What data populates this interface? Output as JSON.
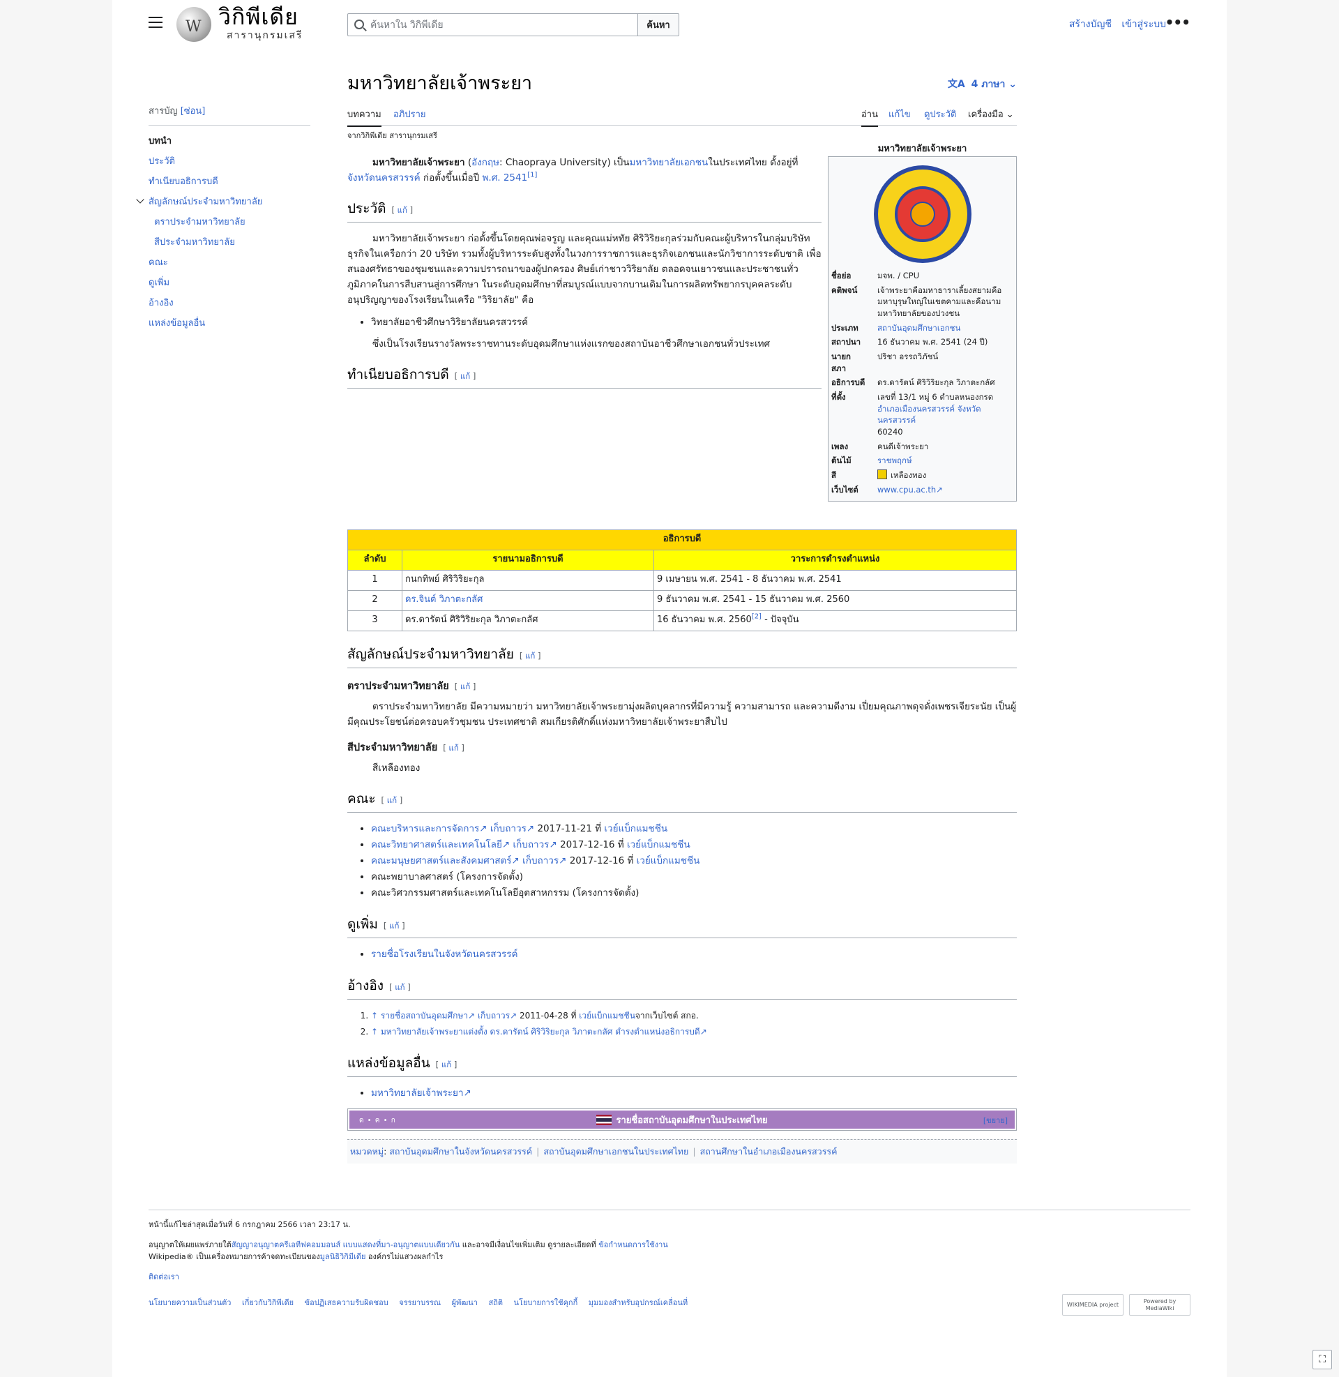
{
  "header": {
    "site_title": "วิกิพีเดีย",
    "site_tagline": "สารานุกรมเสรี",
    "search_placeholder": "ค้นหาใน วิกิพีเดีย",
    "search_button": "ค้นหา",
    "create_account": "สร้างบัญชี",
    "login": "เข้าสู่ระบบ"
  },
  "toc": {
    "heading": "สารบัญ",
    "hide": "[ซ่อน]",
    "items": [
      {
        "label": "บทนำ"
      },
      {
        "label": "ประวัติ"
      },
      {
        "label": "ทำเนียบอธิการบดี"
      },
      {
        "label": "สัญลักษณ์ประจำมหาวิทยาลัย"
      },
      {
        "label": "ตราประจำมหาวิทยาลัย"
      },
      {
        "label": "สีประจำมหาวิทยาลัย"
      },
      {
        "label": "คณะ"
      },
      {
        "label": "ดูเพิ่ม"
      },
      {
        "label": "อ้างอิง"
      },
      {
        "label": "แหล่งข้อมูลอื่น"
      }
    ]
  },
  "article": {
    "title": "มหาวิทยาลัยเจ้าพระยา",
    "languages": "4 ภาษา",
    "tabs": {
      "article": "บทความ",
      "talk": "อภิปราย",
      "read": "อ่าน",
      "edit": "แก้ไข",
      "history": "ดูประวัติ",
      "tools": "เครื่องมือ"
    },
    "from": "จากวิกิพีเดีย สารานุกรมเสรี",
    "edit_label": "แก้",
    "lead": {
      "bold": "มหาวิทยาลัยเจ้าพระยา",
      "open": " (",
      "lang_link": "อังกฤษ",
      "en_name": ": Chaopraya University) เป็น",
      "link1": "มหาวิทยาลัยเอกชน",
      "mid": "ในประเทศไทย ตั้งอยู่ที่",
      "link2": "จังหวัดนครสวรรค์",
      "mid2": " ก่อตั้งขึ้นเมื่อปี ",
      "link3": "พ.ศ. 2541",
      "ref": "[1]"
    },
    "sections": {
      "history": "ประวัติ",
      "deans": "ทำเนียบอธิการบดี",
      "symbols": "สัญลักษณ์ประจำมหาวิทยาลัย",
      "emblem": "ตราประจำมหาวิทยาลัย",
      "color": "สีประจำมหาวิทยาลัย",
      "faculties": "คณะ",
      "seealso": "ดูเพิ่ม",
      "refs": "อ้างอิง",
      "external": "แหล่งข้อมูลอื่น"
    },
    "history_text": "มหาวิทยาลัยเจ้าพระยา ก่อตั้งขึ้นโดยคุณพ่อจรูญ และคุณแม่หทัย ศิริวิริยะกุลร่วมกับคณะผู้บริหารในกลุ่มบริษัทธุรกิจในเครือกว่า 20 บริษัท รวมทั้งผู้บริหารระดับสูงทั้งในวงการราชการและธุรกิจเอกชนและนักวิชาการระดับชาติ เพื่อสนองศรัทธาของชุมชนและความปรารถนาของผู้ปกครอง ศิษย์เก่าชาววิริยาลัย ตลอดจนเยาวชนและประชาชนทั่วภูมิภาคในการสืบสานสู่การศึกษา ในระดับอุดมศึกษาที่สมบูรณ์แบบจากบานเดิมในการผลิตทรัพยากรบุคคลระดับอนุปริญญาของโรงเรียนในเครือ \"วิริยาลัย\" คือ",
    "history_bullet": "วิทยาลัยอาชีวศึกษาวิริยาลัยนครสวรรค์",
    "history_after": "ซึ่งเป็นโรงเรียนรางวัลพระราชทานระดับอุดมศึกษาแห่งแรกของสถาบันอาชีวศึกษาเอกชนทั่วประเทศ",
    "emblem_text": "ตราประจำมหาวิทยาลัย มีความหมายว่า มหาวิทยาลัยเจ้าพระยามุ่งผลิตบุคลากรที่มีความรู้ ความสามารถ และความดีงาม เปี่ยมคุณภาพดุจดั่งเพชรเจียระนัย เป็นผู้มีคุณประโยชน์ต่อครอบครัวชุมชน ประเทศชาติ สมเกียรติศักดิ์แห่งมหาวิทยาลัยเจ้าพระยาสืบไป",
    "color_text": "สีเหลืองทอง",
    "faculties": [
      {
        "name": "คณะบริหารและการจัดการ",
        "archive": "เก็บถาวร",
        "date": " 2017-11-21 ที่ ",
        "wm": "เวย์แบ็กแมชชีน"
      },
      {
        "name": "คณะวิทยาศาสตร์และเทคโนโลยี",
        "archive": "เก็บถาวร",
        "date": " 2017-12-16 ที่ ",
        "wm": "เวย์แบ็กแมชชีน"
      },
      {
        "name": "คณะมนุษยศาสตร์และสังคมศาสตร์",
        "archive": "เก็บถาวร",
        "date": " 2017-12-16 ที่ ",
        "wm": "เวย์แบ็กแมชชีน"
      }
    ],
    "faculties_plain": [
      "คณะพยาบาลศาสตร์ (โครงการจัดตั้ง)",
      "คณะวิศวกรรมศาสตร์และเทคโนโลยีอุตสาหกรรม (โครงการจัดตั้ง)"
    ],
    "seealso_item": "รายชื่อโรงเรียนในจังหวัดนครสวรรค์",
    "refs": [
      {
        "arrow": "↑",
        "link": "รายชื่อสถาบันอุดมศึกษา",
        "archive": "เก็บถาวร",
        "date": " 2011-04-28 ที่ ",
        "wm": "เวย์แบ็กแมชชีน",
        "tail": "จากเว็บไซต์ สกอ."
      },
      {
        "arrow": "↑",
        "link": "มหาวิทยาลัยเจ้าพระยาแต่งตั้ง ดร.ดารัตน์ ศิริวิริยะกุล วิภาตะกลัศ ดำรงตำแหน่งอธิการบดี"
      }
    ],
    "external_item": "มหาวิทยาลัยเจ้าพระยา",
    "ext_icon": "↗"
  },
  "deans_table": {
    "caption": "อธิการบดี",
    "headers": [
      "ลำดับ",
      "รายนามอธิการบดี",
      "วาระการดำรงตำแหน่ง"
    ],
    "rows": [
      {
        "no": "1",
        "name": "กนกทิพย์ ศิริวิริยะกุล",
        "term": "9 เมษายน พ.ศ. 2541 - 8 ธันวาคม พ.ศ. 2541"
      },
      {
        "no": "2",
        "name": "ดร.จินต์ วิภาตะกลัศ",
        "term": "9 ธันวาคม พ.ศ. 2541 - 15 ธันวาคม พ.ศ. 2560"
      },
      {
        "no": "3",
        "name": "ดร.ดารัตน์ ศิริวิริยะกุล วิภาตะกลัศ",
        "term": "16 ธันวาคม พ.ศ. 2560",
        "ref": "[2]",
        "tail": " - ปัจจุบัน"
      }
    ]
  },
  "infobox": {
    "caption": "มหาวิทยาลัยเจ้าพระยา",
    "rows": [
      {
        "label": "ชื่อย่อ",
        "value": "มจพ. / CPU"
      },
      {
        "label": "คติพจน์",
        "value": "เจ้าพระยาคือมหาธาราเลี้ยงสยามคือมหาบุรุษใหญ่ในเขตคามและคือนามมหาวิทยาลัยของปวงชน"
      },
      {
        "label": "ประเภท",
        "value": "สถาบันอุดมศึกษาเอกชน"
      },
      {
        "label": "สถาปนา",
        "value": "16 ธันวาคม พ.ศ. 2541 (24 ปี)"
      },
      {
        "label": "นายกสภา",
        "value": "ปริชา อรรถวิภัชน์"
      },
      {
        "label": "อธิการบดี",
        "value": "ดร.ดารัตน์ ศิริวิริยะกุล วิภาตะกลัศ"
      },
      {
        "label": "ที่ตั้ง",
        "value": "เลขที่ 13/1 หมู่ 6 ตำบลหนองกรด"
      },
      {
        "label": "",
        "value": "อำเภอเมืองนครสวรรค์ จังหวัดนครสวรรค์"
      },
      {
        "label": "",
        "value": "60240"
      },
      {
        "label": "เพลง",
        "value": "คนดีเจ้าพระยา"
      },
      {
        "label": "ต้นไม้",
        "value": "ราชพฤกษ์"
      },
      {
        "label": "สี",
        "value": "เหลืองทอง"
      },
      {
        "label": "เว็บไซต์",
        "value": "www.cpu.ac.th"
      }
    ],
    "swatch_color": "#f2ce00"
  },
  "navbox": {
    "vde": "ด • ค • ก",
    "title": "รายชื่อสถาบันอุดมศึกษาในประเทศไทย",
    "toggle": "[ขยาย]"
  },
  "categories": {
    "label": "หมวดหมู่",
    "items": [
      "สถาบันอุดมศึกษาในจังหวัดนครสวรรค์",
      "สถาบันอุดมศึกษาเอกชนในประเทศไทย",
      "สถานศึกษาในอำเภอเมืองนครสวรรค์"
    ]
  },
  "footer": {
    "last_edit": "หน้านี้แก้ไขล่าสุดเมื่อวันที่ 6 กรกฎาคม 2566 เวลา 23:17 น.",
    "license_a": "อนุญาตให้เผยแพร่ภายใต้",
    "license_link": "สัญญาอนุญาตครีเอทีฟคอมมอนส์ แบบแสดงที่มา-อนุญาตแบบเดียวกัน",
    "license_b": " และอาจมีเงื่อนไขเพิ่มเติม ดูรายละเอียดที่ ",
    "terms_link": "ข้อกำหนดการใช้งาน",
    "trademark_a": "Wikipedia® เป็นเครื่องหมายการค้าจดทะเบียนของ",
    "trademark_link": "มูลนิธิวิกิมีเดีย",
    "trademark_b": " องค์กรไม่แสวงผลกำไร",
    "contact": "ติดต่อเรา",
    "links": [
      "นโยบายความเป็นส่วนตัว",
      "เกี่ยวกับวิกิพีเดีย",
      "ข้อปฏิเสธความรับผิดชอบ",
      "จรรยาบรรณ",
      "ผู้พัฒนา",
      "สถิติ",
      "นโยบายการใช้คุกกี้",
      "มุมมองสำหรับอุปกรณ์เคลื่อนที่"
    ],
    "badge_wikimedia": "WIKIMEDIA project",
    "badge_mediawiki": "Powered by MediaWiki"
  }
}
